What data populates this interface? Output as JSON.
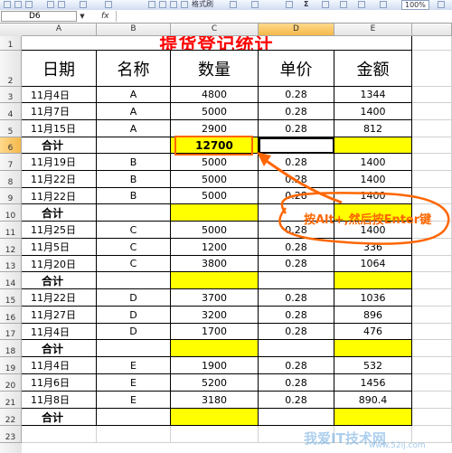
{
  "toolbar": {
    "format_painter_label": "格式刷",
    "zoom": "100%"
  },
  "formula_bar": {
    "name_box": "D6",
    "fx_label": "fx",
    "formula": ""
  },
  "columns": [
    "A",
    "B",
    "C",
    "D",
    "E"
  ],
  "rows": [
    "1",
    "2",
    "3",
    "4",
    "5",
    "6",
    "7",
    "8",
    "9",
    "10",
    "11",
    "12",
    "13",
    "14",
    "15",
    "16",
    "17",
    "18",
    "19",
    "20",
    "21",
    "22",
    "23"
  ],
  "sheet": {
    "title": "提货登记统计",
    "headers": [
      "日期",
      "名称",
      "数量",
      "单价",
      "金额"
    ],
    "data_rows": [
      {
        "row": 3,
        "date": "11月4日",
        "name": "A",
        "qty": "4800",
        "price": "0.28",
        "amount": "1344"
      },
      {
        "row": 4,
        "date": "11月7日",
        "name": "A",
        "qty": "5000",
        "price": "0.28",
        "amount": "1400"
      },
      {
        "row": 5,
        "date": "11月15日",
        "name": "A",
        "qty": "2900",
        "price": "0.28",
        "amount": "812"
      },
      {
        "row": 7,
        "date": "11月19日",
        "name": "B",
        "qty": "5000",
        "price": "0.28",
        "amount": "1400"
      },
      {
        "row": 8,
        "date": "11月22日",
        "name": "B",
        "qty": "5000",
        "price": "0.28",
        "amount": "1400"
      },
      {
        "row": 9,
        "date": "11月22日",
        "name": "B",
        "qty": "5000",
        "price": "0.28",
        "amount": "1400"
      },
      {
        "row": 11,
        "date": "11月25日",
        "name": "C",
        "qty": "5000",
        "price": "0.28",
        "amount": "1400"
      },
      {
        "row": 12,
        "date": "11月5日",
        "name": "C",
        "qty": "1200",
        "price": "0.28",
        "amount": "336"
      },
      {
        "row": 13,
        "date": "11月20日",
        "name": "C",
        "qty": "3800",
        "price": "0.28",
        "amount": "1064"
      },
      {
        "row": 15,
        "date": "11月22日",
        "name": "D",
        "qty": "3700",
        "price": "0.28",
        "amount": "1036"
      },
      {
        "row": 16,
        "date": "11月27日",
        "name": "D",
        "qty": "3200",
        "price": "0.28",
        "amount": "896"
      },
      {
        "row": 17,
        "date": "11月4日",
        "name": "D",
        "qty": "1700",
        "price": "0.28",
        "amount": "476"
      },
      {
        "row": 19,
        "date": "11月4日",
        "name": "E",
        "qty": "1900",
        "price": "0.28",
        "amount": "532"
      },
      {
        "row": 20,
        "date": "11月6日",
        "name": "E",
        "qty": "5200",
        "price": "0.28",
        "amount": "1456"
      },
      {
        "row": 21,
        "date": "11月8日",
        "name": "E",
        "qty": "3180",
        "price": "0.28",
        "amount": "890.4"
      }
    ],
    "total_rows": [
      {
        "row": 6,
        "label": "合计",
        "qty": "12700",
        "amount": ""
      },
      {
        "row": 10,
        "label": "合计",
        "qty": "",
        "amount": ""
      },
      {
        "row": 14,
        "label": "合计",
        "qty": "",
        "amount": ""
      },
      {
        "row": 18,
        "label": "合计",
        "qty": "",
        "amount": ""
      },
      {
        "row": 22,
        "label": "合计",
        "qty": "",
        "amount": ""
      }
    ]
  },
  "annotation": {
    "callout_text": "按Alt+,然后按Enter键",
    "accent_color": "#ff6600",
    "highlight_color": "#ffff00"
  },
  "watermark": {
    "main": "我爱IT技术网",
    "url": "www.52ij.com"
  }
}
